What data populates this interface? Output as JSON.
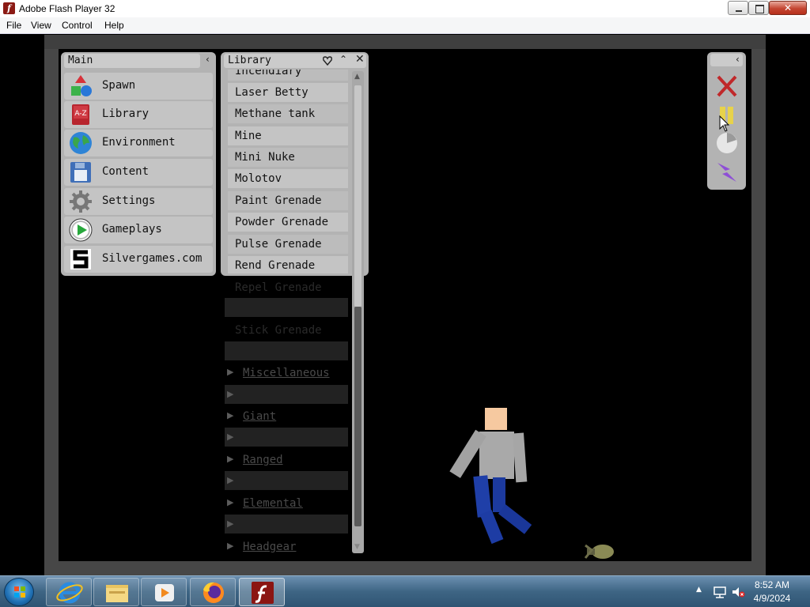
{
  "window": {
    "title": "Adobe Flash Player 32",
    "app_icon_glyph": "f"
  },
  "menu": [
    "File",
    "View",
    "Control",
    "Help"
  ],
  "main_panel": {
    "title": "Main",
    "items": [
      {
        "label": "Spawn",
        "icon": "shapes-icon"
      },
      {
        "label": "Library",
        "icon": "book-az-icon"
      },
      {
        "label": "Environment",
        "icon": "globe-icon"
      },
      {
        "label": "Content",
        "icon": "floppy-disk-icon"
      },
      {
        "label": "Settings",
        "icon": "gear-icon"
      },
      {
        "label": "Gameplays",
        "icon": "play-icon"
      },
      {
        "label": "Silvergames.com",
        "icon": "silvergames-logo-icon"
      }
    ]
  },
  "library_panel": {
    "title": "Library",
    "items": [
      "Incendiary",
      "Laser Betty",
      "Methane tank",
      "Mine",
      "Mini Nuke",
      "Molotov",
      "Paint Grenade",
      "Powder Grenade",
      "Pulse Grenade",
      "Rend Grenade"
    ],
    "overflow_items": [
      "Repel Grenade",
      "",
      "Stick Grenade",
      ""
    ],
    "overflow_categories": [
      "Miscellaneous",
      "",
      "Giant",
      "",
      "Ranged",
      "",
      "Elemental",
      "",
      "Headgear"
    ]
  },
  "tools": [
    "close-x-icon",
    "pause-icon",
    "slow-motion-icon",
    "lightning-icon"
  ],
  "taskbar": {
    "apps": [
      "internet-explorer-icon",
      "file-explorer-icon",
      "media-player-icon",
      "firefox-icon",
      "flash-player-icon"
    ],
    "time": "8:52 AM",
    "date": "4/9/2024"
  },
  "colors": {
    "panel_bg": "#b3b3b3",
    "item_bg": "#c4c4c4",
    "stage_bg": "#000000",
    "close_red": "#c0282a",
    "pause_yellow": "#e7d24a",
    "lightning_purple": "#8e4fd6"
  }
}
